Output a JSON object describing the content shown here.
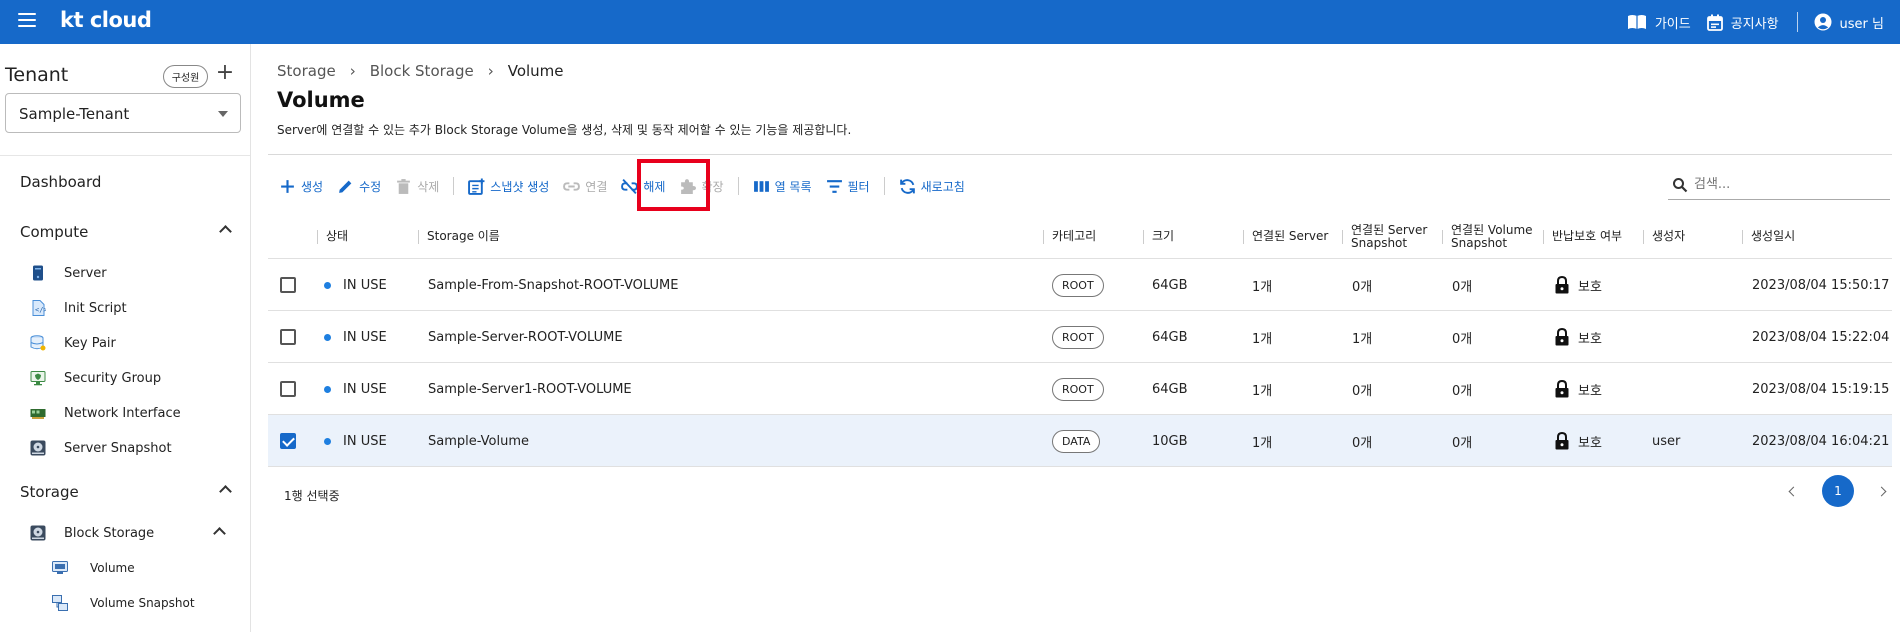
{
  "topbar": {
    "logo_kt": "kt",
    "logo_cloud": "cloud",
    "guide": "가이드",
    "notice": "공지사항",
    "user": "user 님"
  },
  "sidebar": {
    "tenant_title": "Tenant",
    "member_btn": "구성원",
    "plus": "+",
    "tenant_value": "Sample-Tenant",
    "dashboard": "Dashboard",
    "compute": "Compute",
    "compute_items": [
      "Server",
      "Init Script",
      "Key Pair",
      "Security Group",
      "Network Interface",
      "Server Snapshot"
    ],
    "storage": "Storage",
    "block_storage": "Block Storage",
    "block_items": [
      "Volume",
      "Volume Snapshot"
    ]
  },
  "breadcrumb": [
    "Storage",
    "Block Storage",
    "Volume"
  ],
  "page": {
    "title": "Volume",
    "description": "Server에 연결할 수 있는 추가 Block Storage Volume을 생성, 삭제 및 동작 제어할 수 있는 기능을 제공합니다."
  },
  "toolbar": {
    "create": "생성",
    "edit": "수정",
    "delete": "삭제",
    "snapshot": "스냅샷 생성",
    "attach": "연결",
    "detach": "해제",
    "extend": "확장",
    "columns": "열 목록",
    "filter": "필터",
    "refresh": "새로고침"
  },
  "search": {
    "placeholder": "검색..."
  },
  "table": {
    "headers": {
      "status": "상태",
      "name": "Storage 이름",
      "category": "카테고리",
      "size": "크기",
      "server": "연결된 Server",
      "server_snapshot_1": "연결된 Server",
      "server_snapshot_2": "Snapshot",
      "volume_snapshot_1": "연결된 Volume",
      "volume_snapshot_2": "Snapshot",
      "protect": "반납보호 여부",
      "creator": "생성자",
      "created": "생성일시"
    },
    "rows": [
      {
        "checked": false,
        "status": "IN USE",
        "name": "Sample-From-Snapshot-ROOT-VOLUME",
        "category": "ROOT",
        "size": "64GB",
        "server": "1개",
        "server_snapshot": "0개",
        "volume_snapshot": "0개",
        "protect": "보호",
        "creator": "",
        "created": "2023/08/04 15:50:17"
      },
      {
        "checked": false,
        "status": "IN USE",
        "name": "Sample-Server-ROOT-VOLUME",
        "category": "ROOT",
        "size": "64GB",
        "server": "1개",
        "server_snapshot": "1개",
        "volume_snapshot": "0개",
        "protect": "보호",
        "creator": "",
        "created": "2023/08/04 15:22:04"
      },
      {
        "checked": false,
        "status": "IN USE",
        "name": "Sample-Server1-ROOT-VOLUME",
        "category": "ROOT",
        "size": "64GB",
        "server": "1개",
        "server_snapshot": "0개",
        "volume_snapshot": "0개",
        "protect": "보호",
        "creator": "",
        "created": "2023/08/04 15:19:15"
      },
      {
        "checked": true,
        "status": "IN USE",
        "name": "Sample-Volume",
        "category": "DATA",
        "size": "10GB",
        "server": "1개",
        "server_snapshot": "0개",
        "volume_snapshot": "0개",
        "protect": "보호",
        "creator": "user",
        "created": "2023/08/04 16:04:21"
      }
    ]
  },
  "footer": {
    "selected": "1행 선택중",
    "page": "1"
  },
  "colors": {
    "brand": "#1669c9",
    "highlight": "#e8001c",
    "selected_row": "#ebf2fb"
  }
}
